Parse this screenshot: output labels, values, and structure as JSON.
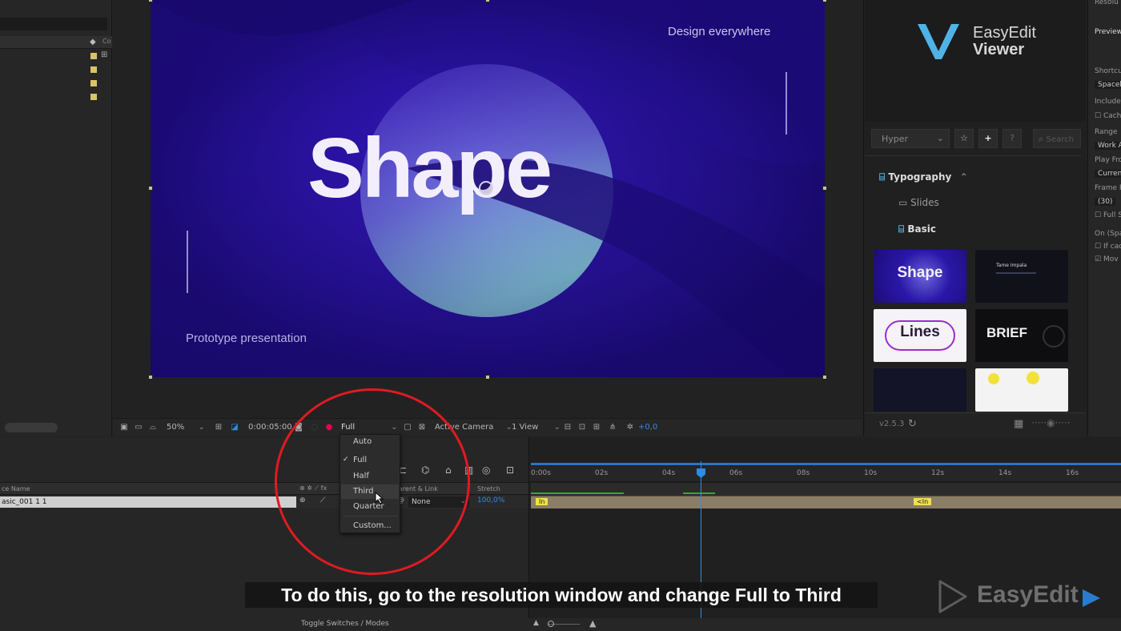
{
  "comp": {
    "tagline": "Design everywhere",
    "headline": "Shape",
    "subtitle": "Prototype presentation"
  },
  "viewer_toolbar": {
    "zoom": "50%",
    "timecode": "0:00:05:00",
    "resolution": "Full",
    "camera": "Active Camera",
    "views": "1 View",
    "exposure": "+0,0"
  },
  "resolution_menu": {
    "items": [
      "Auto",
      "Full",
      "Half",
      "Third",
      "Quarter",
      "Custom..."
    ],
    "checked": "Full",
    "hovered": "Third"
  },
  "right_panel": {
    "brand_line1": "EasyEdit",
    "brand_line2": "Viewer",
    "category_select": "Hyper",
    "search_placeholder": "Search",
    "folder_typography": "Typography",
    "folder_slides": "Slides",
    "folder_basic": "Basic",
    "thumbnails": [
      "Shape",
      "Tame Impala",
      "Lines",
      "BRIEF",
      "",
      ""
    ],
    "version": "v2.5.3"
  },
  "far_right": {
    "labels": [
      "Resolu",
      "Preview",
      "Shortcu",
      "Spaceb",
      "Include:",
      "Cach",
      "Range",
      "Work A",
      "Play Fro",
      "Curren",
      "Frame R",
      "(30)",
      "Full S",
      "On (Spa",
      "If cac",
      "Mov"
    ]
  },
  "timeline": {
    "col_source_name": "ce Name",
    "col_parent_link": "arent & Link",
    "col_stretch": "Stretch",
    "layer_name": "asic_001 1 1",
    "layer_parent": "None",
    "layer_stretch": "100,0%",
    "ruler": [
      "0:00s",
      "02s",
      "04s",
      "06s",
      "08s",
      "10s",
      "12s",
      "14s",
      "16s"
    ],
    "marker_in_1": "In",
    "marker_in_2": "<In",
    "toggle_label": "Toggle Switches / Modes"
  },
  "caption": "To do this, go to the resolution window and change Full to Third",
  "watermark": "EasyEdit",
  "colors": {
    "accent_blue": "#2d8ceb",
    "highlight_red": "#e01a22",
    "label_yellow": "#d8c36a",
    "comp_bg": "#26108f"
  }
}
